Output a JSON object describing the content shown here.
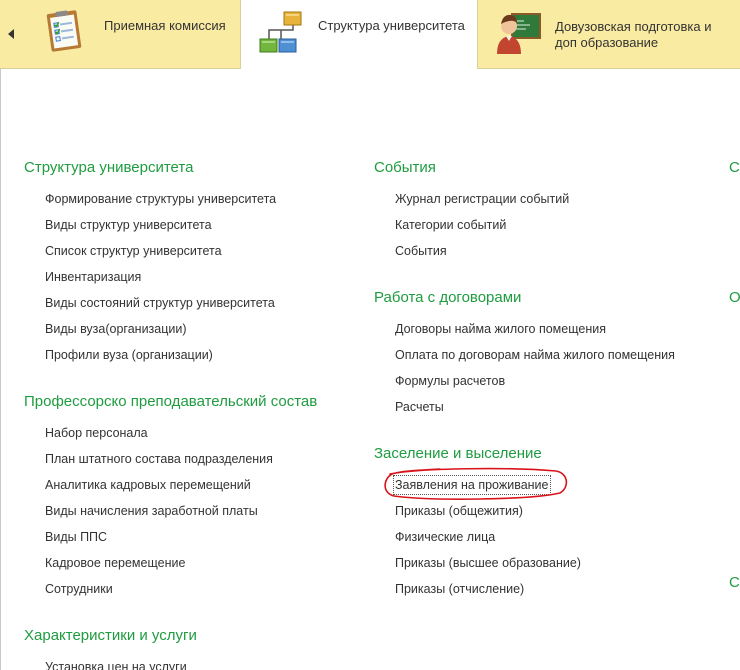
{
  "tabs": [
    {
      "label": "Приемная комиссия",
      "icon": "checklist-board-icon",
      "active": false
    },
    {
      "label": "Структура университета",
      "icon": "org-structure-icon",
      "active": true
    },
    {
      "label_lines": [
        "Довузовская подготовка и",
        "доп образование"
      ],
      "icon": "teacher-icon",
      "active": false
    }
  ],
  "columns": {
    "left": {
      "groups": [
        {
          "title": "Структура университета",
          "items": [
            "Формирование структуры университета",
            "Виды структур университета",
            "Список структур университета",
            "Инвентаризация",
            "Виды состояний структур университета",
            "Виды вуза(организации)",
            "Профили вуза (организации)"
          ]
        },
        {
          "title": "Профессорско преподавательский состав",
          "items": [
            "Набор персонала",
            "План штатного состава подразделения",
            "Аналитика кадровых перемещений",
            "Виды начисления заработной платы",
            "Виды ППС",
            "Кадровое перемещение",
            "Сотрудники"
          ]
        },
        {
          "title": "Характеристики и услуги",
          "items": [
            "Установка цен на услуги"
          ]
        }
      ]
    },
    "middle": {
      "groups": [
        {
          "title": "События",
          "items": [
            "Журнал регистрации событий",
            "Категории событий",
            "События"
          ]
        },
        {
          "title": "Работа с договорами",
          "items": [
            "Договоры найма жилого помещения",
            "Оплата по договорам найма жилого помещения",
            "Формулы расчетов",
            "Расчеты"
          ]
        },
        {
          "title": "Заселение и выселение",
          "items": [
            "Заявления на проживание",
            "Приказы (общежития)",
            "Физические лица",
            "Приказы (высшее образование)",
            "Приказы (отчисление)"
          ]
        }
      ]
    },
    "right_cut_titles": [
      "С",
      "О",
      "С"
    ]
  },
  "highlight": {
    "target": "Заявления на проживание",
    "color": "#d8141a"
  },
  "colors": {
    "tabbar": "#faeba3",
    "group_title": "#1f9c40",
    "link_text": "#333333"
  }
}
